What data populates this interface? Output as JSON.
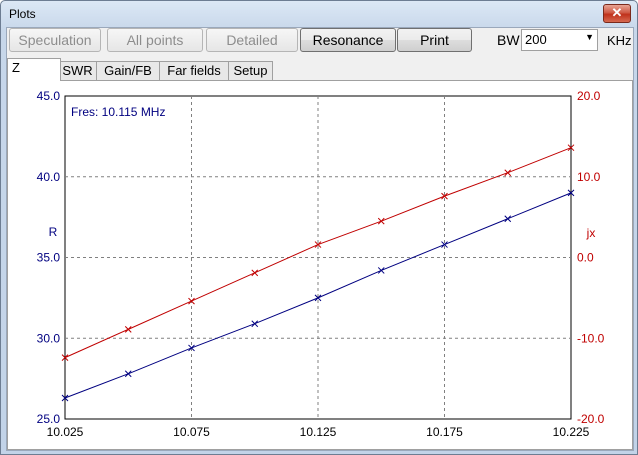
{
  "window": {
    "title": "Plots",
    "close_glyph": "✕"
  },
  "toolbar": {
    "buttons": [
      {
        "label": "Speculation",
        "enabled": false
      },
      {
        "label": "All points",
        "enabled": false
      },
      {
        "label": "Detailed",
        "enabled": false
      },
      {
        "label": "Resonance",
        "enabled": true
      },
      {
        "label": "Print",
        "enabled": true
      }
    ],
    "bw_label": "BW",
    "bw_value": "200",
    "bw_unit": "KHz"
  },
  "tabs": [
    {
      "label": "Z",
      "active": true
    },
    {
      "label": "SWR",
      "active": false
    },
    {
      "label": "Gain/FB",
      "active": false
    },
    {
      "label": "Far fields",
      "active": false
    },
    {
      "label": "Setup",
      "active": false
    }
  ],
  "colors": {
    "r_series": "#000080",
    "jx_series": "#c00000",
    "grid": "#808080"
  },
  "chart_data": {
    "type": "line",
    "annotation": "Fres: 10.115 MHz",
    "xlim": [
      10.025,
      10.225
    ],
    "x_ticks": [
      "10.025",
      "10.075",
      "10.125",
      "10.175",
      "10.225"
    ],
    "y_left": {
      "label": "R",
      "lim": [
        25,
        45
      ],
      "ticks": [
        "25.0",
        "30.0",
        "35.0",
        "40.0",
        "45.0"
      ]
    },
    "y_right": {
      "label": "jx",
      "lim": [
        -20,
        20
      ],
      "ticks": [
        "-20.0",
        "-10.0",
        "0.0",
        "10.0",
        "20.0"
      ]
    },
    "x": [
      10.025,
      10.05,
      10.075,
      10.1,
      10.125,
      10.15,
      10.175,
      10.2,
      10.225
    ],
    "series": [
      {
        "name": "R",
        "axis": "left",
        "values": [
          26.3,
          27.8,
          29.4,
          30.9,
          32.5,
          34.2,
          35.8,
          37.4,
          39.0
        ]
      },
      {
        "name": "jx",
        "axis": "right",
        "values": [
          -12.4,
          -8.9,
          -5.4,
          -1.9,
          1.6,
          4.5,
          7.6,
          10.5,
          13.6
        ]
      }
    ],
    "grid": true,
    "marker": "x"
  }
}
